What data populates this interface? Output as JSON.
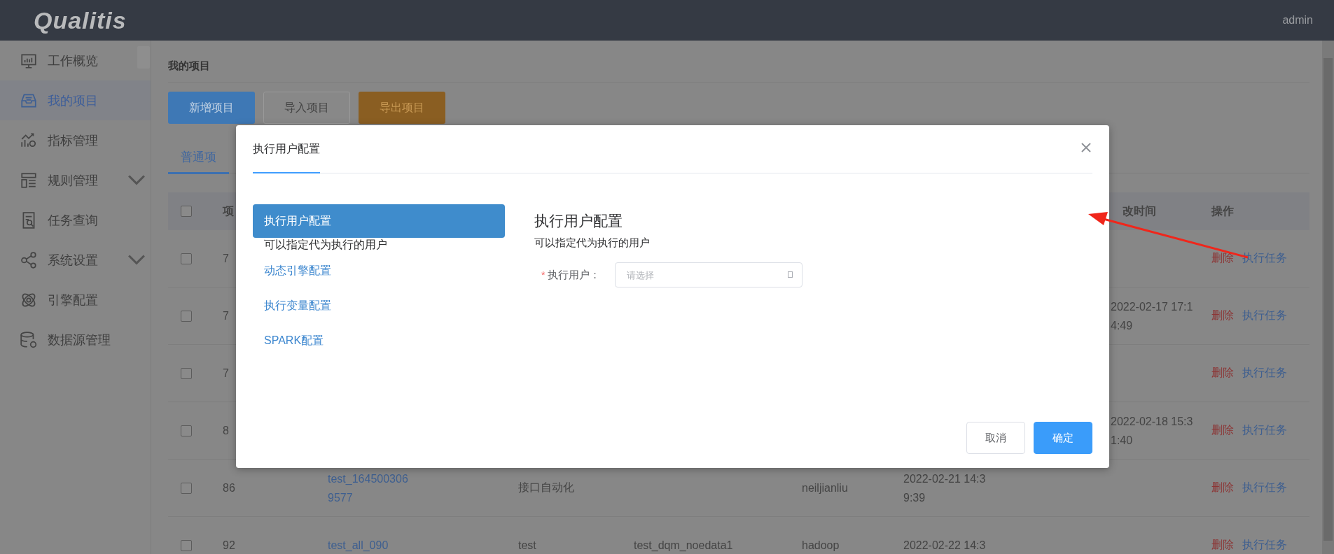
{
  "header": {
    "logo": "Qualitis",
    "user": "admin"
  },
  "sidebar": {
    "items": [
      {
        "label": "工作概览",
        "selected": false,
        "has_submenu": false
      },
      {
        "label": "我的项目",
        "selected": true,
        "has_submenu": false
      },
      {
        "label": "指标管理",
        "selected": false,
        "has_submenu": false
      },
      {
        "label": "规则管理",
        "selected": false,
        "has_submenu": true
      },
      {
        "label": "任务查询",
        "selected": false,
        "has_submenu": false
      },
      {
        "label": "系统设置",
        "selected": false,
        "has_submenu": true
      },
      {
        "label": "引擎配置",
        "selected": false,
        "has_submenu": false
      },
      {
        "label": "数据源管理",
        "selected": false,
        "has_submenu": false
      }
    ]
  },
  "page": {
    "title": "我的项目",
    "buttons": [
      {
        "label": "新增项目",
        "kind": "primary"
      },
      {
        "label": "导入项目",
        "kind": "default"
      },
      {
        "label": "导出项目",
        "kind": "warning"
      }
    ],
    "tabs": [
      {
        "label": "普通项",
        "selected": true
      }
    ],
    "table": {
      "select_all_checked": false,
      "columns": {
        "id": "项",
        "modified": "改时间",
        "actions": "操作"
      },
      "rows": [
        {
          "checked": false,
          "id": "7",
          "modified": "",
          "actions": [
            "删除",
            "执行任务"
          ]
        },
        {
          "checked": false,
          "id": "7",
          "modified": "2022-02-17 17:14:49",
          "actions": [
            "删除",
            "执行任务"
          ]
        },
        {
          "checked": false,
          "id": "7",
          "modified": "",
          "actions": [
            "删除",
            "执行任务"
          ]
        },
        {
          "checked": false,
          "id": "8",
          "modified": "2022-02-18 15:31:40",
          "actions": [
            "删除",
            "执行任务"
          ]
        },
        {
          "checked": false,
          "id": "86",
          "name": "test_1645003069577",
          "type": "接口自动化",
          "source": "",
          "user": "neiljianliu",
          "created": "2022-02-21 14:39:39",
          "modified": "",
          "actions": [
            "删除",
            "执行任务"
          ]
        },
        {
          "checked": false,
          "id": "92",
          "name": "test_all_090",
          "type": "test",
          "source": "test_dqm_noedata1",
          "user": "hadoop",
          "created": "2022-02-22 14:3",
          "modified": "",
          "actions": [
            "删除",
            "执行任务"
          ]
        }
      ]
    }
  },
  "dialog": {
    "tab": "执行用户配置",
    "menu": [
      {
        "label": "执行用户配置",
        "description": "可以指定代为执行的用户",
        "selected": true
      },
      {
        "label": "动态引擎配置",
        "selected": false
      },
      {
        "label": "执行变量配置",
        "selected": false
      },
      {
        "label": "SPARK配置",
        "selected": false
      }
    ],
    "heading": "执行用户配置",
    "description": "可以指定代为执行的用户",
    "field": {
      "required_mark": "*",
      "label": "执行用户：",
      "required": true,
      "placeholder": "请选择"
    },
    "buttons": [
      {
        "label": "取消",
        "kind": "default"
      },
      {
        "label": "确定",
        "kind": "primary"
      }
    ]
  }
}
